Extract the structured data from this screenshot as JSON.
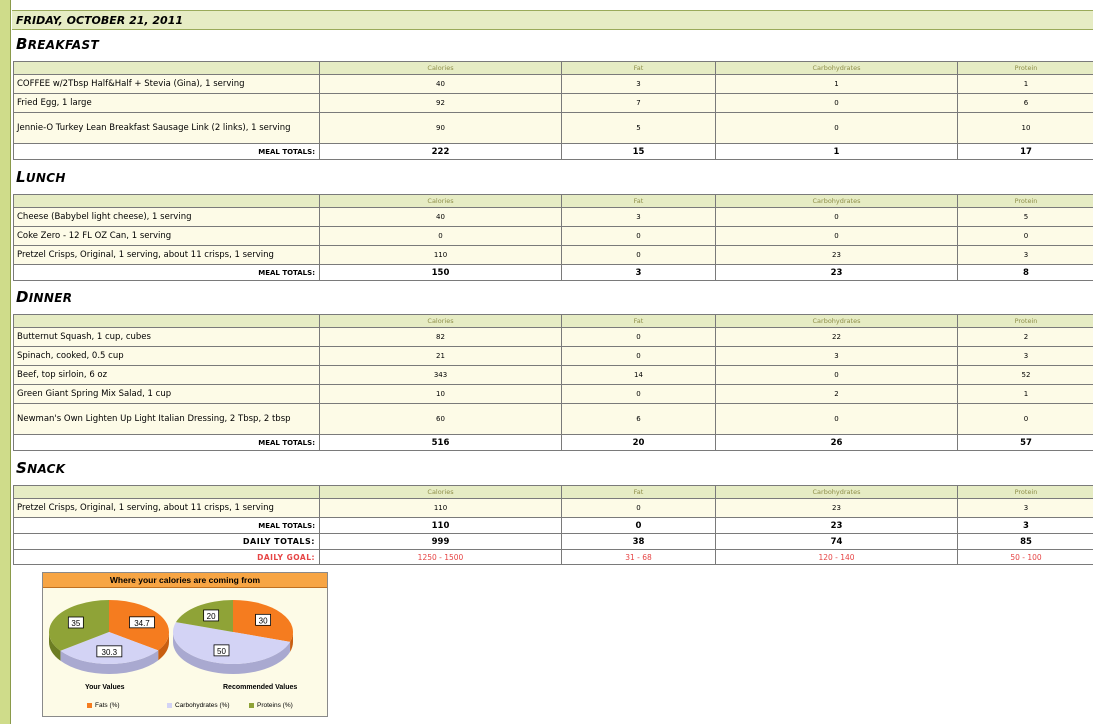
{
  "date": "FRIDAY, OCTOBER 21, 2011",
  "columns": {
    "calories": "Calories",
    "fat": "Fat",
    "carbs": "Carbohydrates",
    "protein": "Protein"
  },
  "meal_totals_label": "MEAL TOTALS:",
  "meals": {
    "breakfast": {
      "title_first": "B",
      "title_rest": "REAKFAST",
      "items": [
        {
          "name": "COFFEE w/2Tbsp Half&Half + Stevia (Gina), 1 serving",
          "calories": "40",
          "fat": "3",
          "carbs": "1",
          "protein": "1"
        },
        {
          "name": "Fried Egg, 1 large",
          "calories": "92",
          "fat": "7",
          "carbs": "0",
          "protein": "6"
        },
        {
          "name": "Jennie-O Turkey Lean Breakfast Sausage Link (2 links), 1 serving",
          "calories": "90",
          "fat": "5",
          "carbs": "0",
          "protein": "10"
        }
      ],
      "totals": {
        "calories": "222",
        "fat": "15",
        "carbs": "1",
        "protein": "17"
      }
    },
    "lunch": {
      "title_first": "L",
      "title_rest": "UNCH",
      "items": [
        {
          "name": "Cheese (Babybel light cheese), 1 serving",
          "calories": "40",
          "fat": "3",
          "carbs": "0",
          "protein": "5"
        },
        {
          "name": "Coke Zero - 12 FL OZ Can, 1 serving",
          "calories": "0",
          "fat": "0",
          "carbs": "0",
          "protein": "0"
        },
        {
          "name": "Pretzel Crisps, Original, 1 serving, about 11 crisps, 1 serving",
          "calories": "110",
          "fat": "0",
          "carbs": "23",
          "protein": "3"
        }
      ],
      "totals": {
        "calories": "150",
        "fat": "3",
        "carbs": "23",
        "protein": "8"
      }
    },
    "dinner": {
      "title_first": "D",
      "title_rest": "INNER",
      "items": [
        {
          "name": "Butternut Squash, 1 cup, cubes",
          "calories": "82",
          "fat": "0",
          "carbs": "22",
          "protein": "2"
        },
        {
          "name": "Spinach, cooked, 0.5 cup",
          "calories": "21",
          "fat": "0",
          "carbs": "3",
          "protein": "3"
        },
        {
          "name": "Beef, top sirloin, 6 oz",
          "calories": "343",
          "fat": "14",
          "carbs": "0",
          "protein": "52"
        },
        {
          "name": "Green Giant Spring Mix Salad, 1 cup",
          "calories": "10",
          "fat": "0",
          "carbs": "2",
          "protein": "1"
        },
        {
          "name": "Newman's Own Lighten Up Light Italian Dressing, 2 Tbsp, 2 tbsp",
          "calories": "60",
          "fat": "6",
          "carbs": "0",
          "protein": "0"
        }
      ],
      "totals": {
        "calories": "516",
        "fat": "20",
        "carbs": "26",
        "protein": "57"
      }
    },
    "snack": {
      "title_first": "S",
      "title_rest": "NACK",
      "items": [
        {
          "name": "Pretzel Crisps, Original, 1 serving, about 11 crisps, 1 serving",
          "calories": "110",
          "fat": "0",
          "carbs": "23",
          "protein": "3"
        }
      ],
      "totals": {
        "calories": "110",
        "fat": "0",
        "carbs": "23",
        "protein": "3"
      }
    }
  },
  "daily_totals": {
    "label": "DAILY TOTALS:",
    "calories": "999",
    "fat": "38",
    "carbs": "74",
    "protein": "85"
  },
  "daily_goal": {
    "label": "DAILY GOAL:",
    "calories": "1250 - 1500",
    "fat": "31 - 68",
    "carbs": "120 - 140",
    "protein": "50 - 100"
  },
  "colors": {
    "fats": "#f57c1f",
    "carbs": "#d3d3f5",
    "proteins": "#8fa337",
    "goal_text": "#e64545",
    "header_bg": "#e6ecc4"
  },
  "chart_data": {
    "type": "pie",
    "title": "Where your calories are coming from",
    "categories": [
      "Fats (%)",
      "Carbohydrates (%)",
      "Proteins (%)"
    ],
    "series": [
      {
        "name": "Your Values",
        "values": [
          34.7,
          30.3,
          35
        ]
      },
      {
        "name": "Recommended Values",
        "values": [
          30,
          50,
          20
        ]
      }
    ],
    "legend": "bottom"
  }
}
